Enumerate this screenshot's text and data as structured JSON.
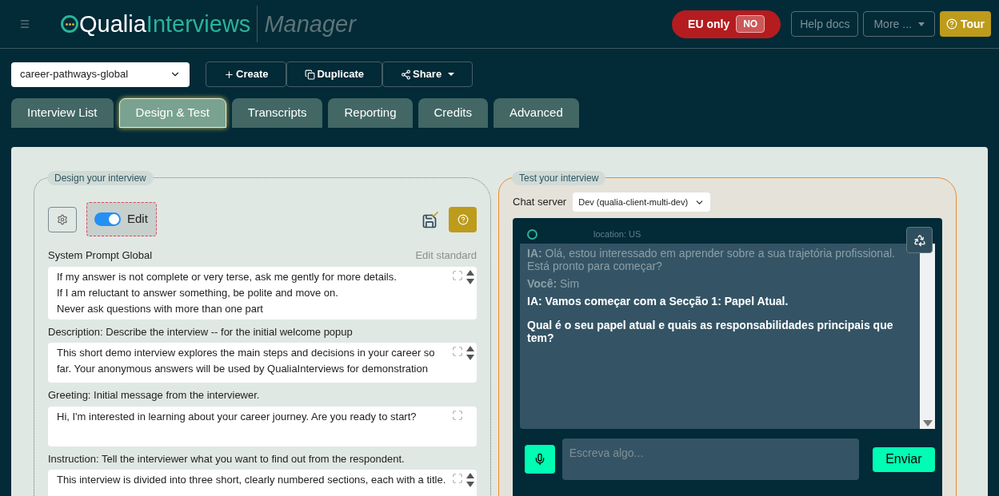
{
  "header": {
    "logo_left": "Qualia",
    "logo_right": "Interviews",
    "subtitle": "Manager",
    "eu_only": {
      "label": "EU only",
      "value": "NO"
    },
    "buttons": [
      {
        "label": "Help docs",
        "kind": "outline"
      },
      {
        "label": "More ...",
        "kind": "dropdown"
      },
      {
        "label": "Tour",
        "kind": "help"
      }
    ]
  },
  "toolbar": {
    "project": "career-pathways-global",
    "actions": [
      {
        "label": "Create",
        "kind": "create"
      },
      {
        "label": "Duplicate",
        "kind": "duplicate"
      },
      {
        "label": "Share",
        "kind": "share"
      }
    ]
  },
  "tabs": [
    {
      "label": "Interview List",
      "selected": false
    },
    {
      "label": "Design & Test",
      "selected": true
    },
    {
      "label": "Transcripts",
      "selected": false
    },
    {
      "label": "Reporting",
      "selected": false
    },
    {
      "label": "Credits",
      "selected": false
    },
    {
      "label": "Advanced",
      "selected": false
    }
  ],
  "design": {
    "legend": "Design your interview",
    "edit_toggle": {
      "label": "Edit",
      "on": true
    },
    "fields": [
      {
        "label": "System Prompt Global",
        "link": "Edit standard",
        "lines": [
          "If my answer is not complete or very terse, ask me gently for more details.",
          "If I am reluctant to answer something, be polite and move on.",
          "Never ask questions with more than one part"
        ],
        "scroller": true
      },
      {
        "label": "Description: Describe the interview -- for the initial welcome popup",
        "lines": [
          "This short demo interview explores the main steps and decisions in your career so",
          "far. Your anonymous answers will be used by QualiaInterviews for demonstration"
        ],
        "scroller": true
      },
      {
        "label": "Greeting: Initial message from the interviewer.",
        "lines": [
          "Hi, I'm interested in learning about your career journey. Are you ready to start?"
        ],
        "scroller": false
      },
      {
        "label": "Instruction: Tell the interviewer what you want to find out from the respondent.",
        "lines": [
          "This interview is divided into three short, clearly numbered sections, each with a title."
        ],
        "scroller": true
      }
    ]
  },
  "test": {
    "legend": "Test your interview",
    "server_label": "Chat server",
    "server": "Dev (qualia-client-multi-dev)",
    "location": "location: US",
    "messages": [
      {
        "speaker": "IA:",
        "text": "Olá, estou interessado em aprender sobre a sua trajetória profissional. Está pronto para começar?",
        "dimmed": true
      },
      {
        "speaker": "Você:",
        "text": "Sim",
        "dimmed": true
      },
      {
        "speaker": "IA:",
        "text": "Vamos começar com a Secção 1: Papel Atual.",
        "dimmed": false
      },
      {
        "text": "Qual é o seu papel atual e quais as responsabilidades principais que tem?",
        "dimmed": false
      }
    ],
    "input_placeholder": "Escreva algo...",
    "send": "Enviar"
  }
}
